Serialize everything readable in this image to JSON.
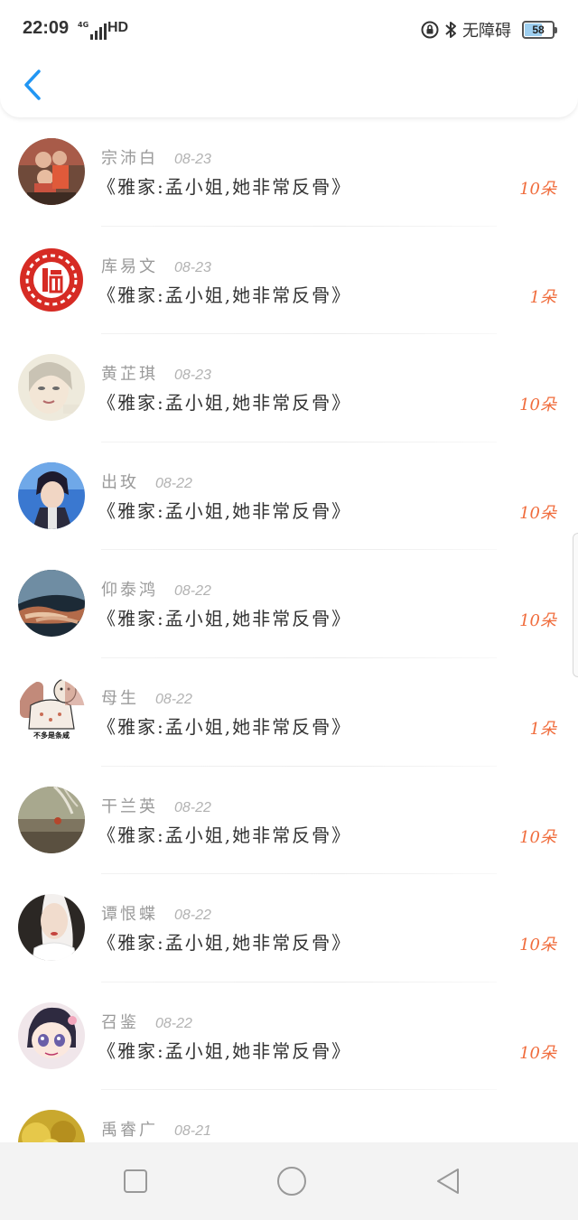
{
  "status_bar": {
    "time": "22:09",
    "network_type": "4G",
    "hd_label": "HD",
    "accessibility_label": "无障碍",
    "battery_level": "58",
    "battery_fraction": 0.58
  },
  "header": {
    "back_icon": "chevron-left-icon",
    "accent_color": "#2196f3"
  },
  "colors": {
    "amount": "#f06c3c",
    "name": "#9a9a9a",
    "title": "#333333"
  },
  "list": [
    {
      "name": "宗沛白",
      "date": "08-23",
      "title": "《雅家:孟小姐,她非常反骨》",
      "amount": "10朵"
    },
    {
      "name": "库易文",
      "date": "08-23",
      "title": "《雅家:孟小姐,她非常反骨》",
      "amount": "1朵"
    },
    {
      "name": "黄芷琪",
      "date": "08-23",
      "title": "《雅家:孟小姐,她非常反骨》",
      "amount": "10朵"
    },
    {
      "name": "出玫",
      "date": "08-22",
      "title": "《雅家:孟小姐,她非常反骨》",
      "amount": "10朵"
    },
    {
      "name": "仰泰鸿",
      "date": "08-22",
      "title": "《雅家:孟小姐,她非常反骨》",
      "amount": "10朵"
    },
    {
      "name": "母生",
      "date": "08-22",
      "title": "《雅家:孟小姐,她非常反骨》",
      "amount": "1朵"
    },
    {
      "name": "干兰英",
      "date": "08-22",
      "title": "《雅家:孟小姐,她非常反骨》",
      "amount": "10朵"
    },
    {
      "name": "谭恨蝶",
      "date": "08-22",
      "title": "《雅家:孟小姐,她非常反骨》",
      "amount": "10朵"
    },
    {
      "name": "召鉴",
      "date": "08-22",
      "title": "《雅家:孟小姐,她非常反骨》",
      "amount": "10朵"
    },
    {
      "name": "禹睿广",
      "date": "08-21",
      "title": "",
      "amount": ""
    }
  ],
  "avatars": {
    "avatar_4_caption": "不多是条咸"
  },
  "nav_bar": {
    "recent_icon": "square-icon",
    "home_icon": "circle-icon",
    "back_icon": "triangle-back-icon"
  }
}
